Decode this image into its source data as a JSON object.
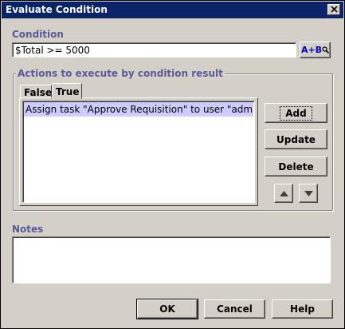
{
  "window": {
    "title": "Evaluate Condition"
  },
  "condition": {
    "label": "Condition",
    "value": "$Total >= 5000",
    "expression_button": "A+B"
  },
  "actions": {
    "group_label": "Actions to execute by condition result",
    "tabs": [
      {
        "label": "False",
        "selected": false
      },
      {
        "label": "True",
        "selected": true
      }
    ],
    "items": [
      "Assign task \"Approve Requisition\" to user \"admin\""
    ],
    "buttons": {
      "add": "Add",
      "update": "Update",
      "delete": "Delete"
    }
  },
  "notes": {
    "label": "Notes",
    "value": ""
  },
  "footer": {
    "ok": "OK",
    "cancel": "Cancel",
    "help": "Help"
  },
  "icons": {
    "close": "close-icon",
    "move_up": "arrow-up-icon",
    "move_down": "arrow-down-icon",
    "expression": "magnifier-icon"
  },
  "colors": {
    "titlebar": "#0a246a",
    "section_label": "#5a5a9a",
    "selection": "#ccccff",
    "expression_text": "#0000cc"
  }
}
